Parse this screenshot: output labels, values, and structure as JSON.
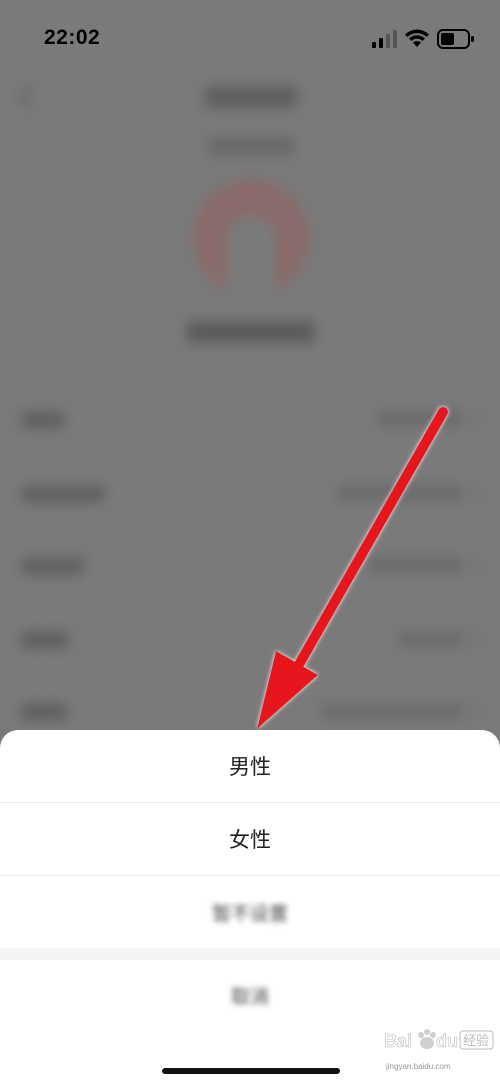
{
  "status_bar": {
    "time": "22:02",
    "signal_icon": "cellular-signal-icon",
    "wifi_icon": "wifi-icon",
    "battery_icon": "battery-icon"
  },
  "action_sheet": {
    "options": [
      "男性",
      "女性"
    ],
    "blurred_option": "暂不设置",
    "cancel_label": "取消"
  },
  "annotation": {
    "arrow_color": "#e8121c"
  },
  "watermark": {
    "brand": "Bai du 经验",
    "url": "jingyan.baidu.com"
  }
}
